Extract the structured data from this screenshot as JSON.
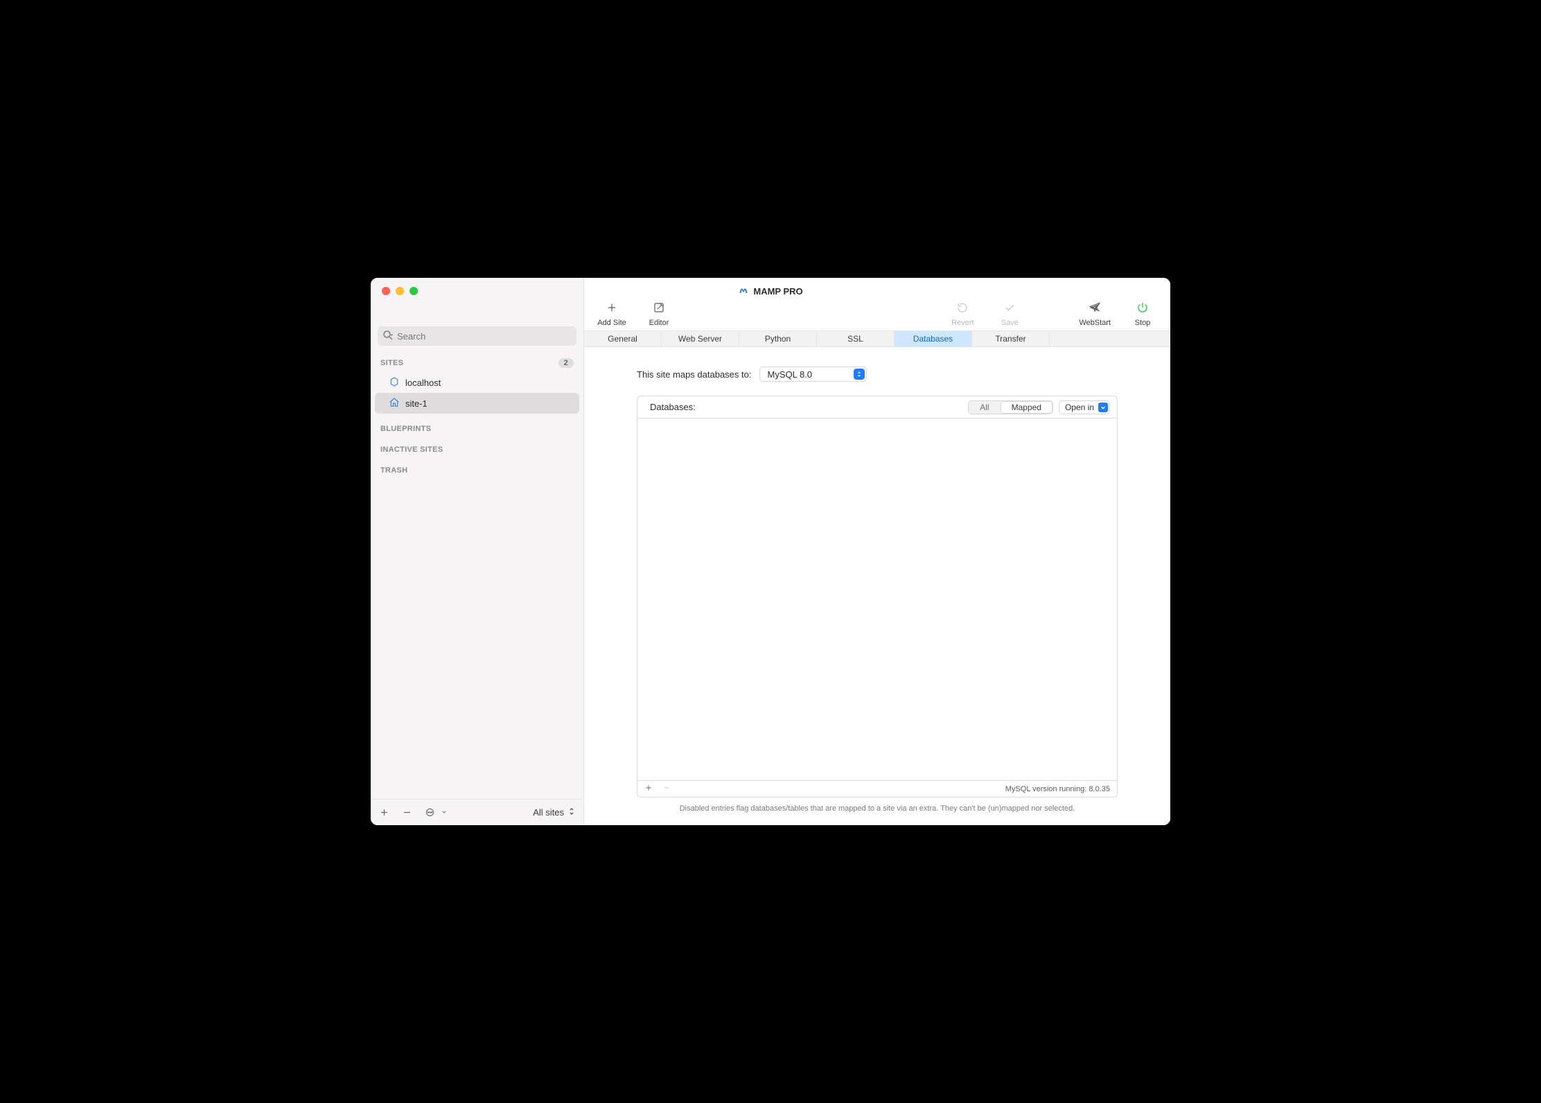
{
  "window": {
    "title": "MAMP PRO"
  },
  "toolbar": {
    "add_site": "Add Site",
    "editor": "Editor",
    "revert": "Revert",
    "save": "Save",
    "webstart": "WebStart",
    "stop": "Stop"
  },
  "sidebar": {
    "search_placeholder": "Search",
    "sections": {
      "sites": {
        "label": "SITES",
        "count": "2"
      },
      "blueprints": {
        "label": "BLUEPRINTS"
      },
      "inactive": {
        "label": "INACTIVE SITES"
      },
      "trash": {
        "label": "TRASH"
      }
    },
    "sites": [
      {
        "name": "localhost"
      },
      {
        "name": "site-1"
      }
    ],
    "footer_select": "All sites"
  },
  "tabs": {
    "general": "General",
    "webserver": "Web Server",
    "python": "Python",
    "ssl": "SSL",
    "databases": "Databases",
    "transfer": "Transfer"
  },
  "content": {
    "map_label": "This site maps databases to:",
    "map_value": "MySQL 8.0",
    "db_header": "Databases:",
    "filter_all": "All",
    "filter_mapped": "Mapped",
    "open_in": "Open in",
    "version_label": "MySQL version running: 8.0.35",
    "hint": "Disabled entries flag databases/tables that are mapped to a site via an extra. They can't be (un)mapped nor selected."
  }
}
